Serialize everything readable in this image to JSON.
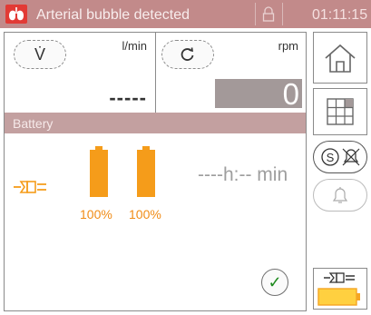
{
  "titlebar": {
    "alarm_text": "Arterial bubble detected",
    "time": "01:11:15",
    "logo_icon": "lungs-icon",
    "lock_icon": "lock-icon"
  },
  "flow_panel": {
    "button_symbol": "V̇",
    "unit": "l/min",
    "value": "-----"
  },
  "rpm_panel": {
    "button_icon": "rotate-icon",
    "unit": "rpm",
    "value": "0"
  },
  "battery": {
    "title": "Battery",
    "power_icon": "mains-plug-icon",
    "batteries": [
      {
        "label": "100%",
        "level": 1.0
      },
      {
        "label": "100%",
        "level": 1.0
      }
    ],
    "runtime": "----h:-- min",
    "confirm_icon": "checkmark-icon"
  },
  "sidebar": {
    "items": [
      {
        "name": "home",
        "icon": "home-icon"
      },
      {
        "name": "layout",
        "icon": "grid-icon"
      },
      {
        "name": "mute",
        "icon": "silence-alarm-icon",
        "symbol": "S"
      },
      {
        "name": "alarm",
        "icon": "bell-icon"
      },
      {
        "name": "power",
        "icon": "mains-battery-icon",
        "battery_level": 1.0
      }
    ]
  },
  "colors": {
    "titlebar": "#c28a8a",
    "alarm_logo": "#e23a35",
    "battery_orange": "#f59c1a",
    "section_bar": "#c3a0a0",
    "rpm_box": "#a39999"
  }
}
